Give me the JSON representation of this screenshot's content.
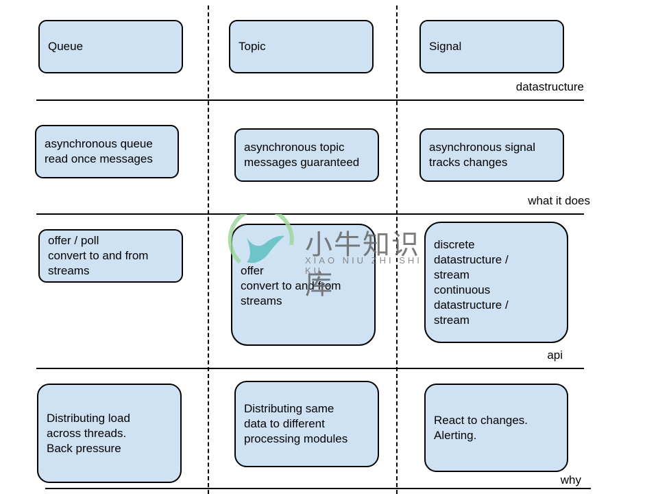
{
  "columns": [
    "Queue",
    "Topic",
    "Signal"
  ],
  "rows": [
    {
      "label": "datastructure",
      "cells": [
        [
          "Queue"
        ],
        [
          "Topic"
        ],
        [
          "Signal"
        ]
      ]
    },
    {
      "label": "what it does",
      "cells": [
        [
          "asynchronous queue",
          "read once messages"
        ],
        [
          "asynchronous topic",
          "messages guaranteed"
        ],
        [
          "asynchronous signal",
          "tracks changes"
        ]
      ]
    },
    {
      "label": "api",
      "cells": [
        [
          "offer / poll",
          "convert to and from",
          "streams"
        ],
        [
          "offer",
          "convert to and from",
          "streams"
        ],
        [
          "discrete",
          "datastructure /",
          "stream",
          "continuous",
          "datastructure /",
          "stream"
        ]
      ]
    },
    {
      "label": "why",
      "cells": [
        [
          "Distributing load",
          "across threads.",
          "Back pressure"
        ],
        [
          "Distributing same",
          "data to different",
          "processing modules"
        ],
        [
          "React to changes.",
          "Alerting."
        ]
      ]
    }
  ],
  "colors": {
    "box_fill": "#cfe2f3",
    "line": "#000000"
  },
  "watermark": {
    "text": "小牛知识库",
    "subtext": "XIAO NIU ZHI SHI KU"
  }
}
